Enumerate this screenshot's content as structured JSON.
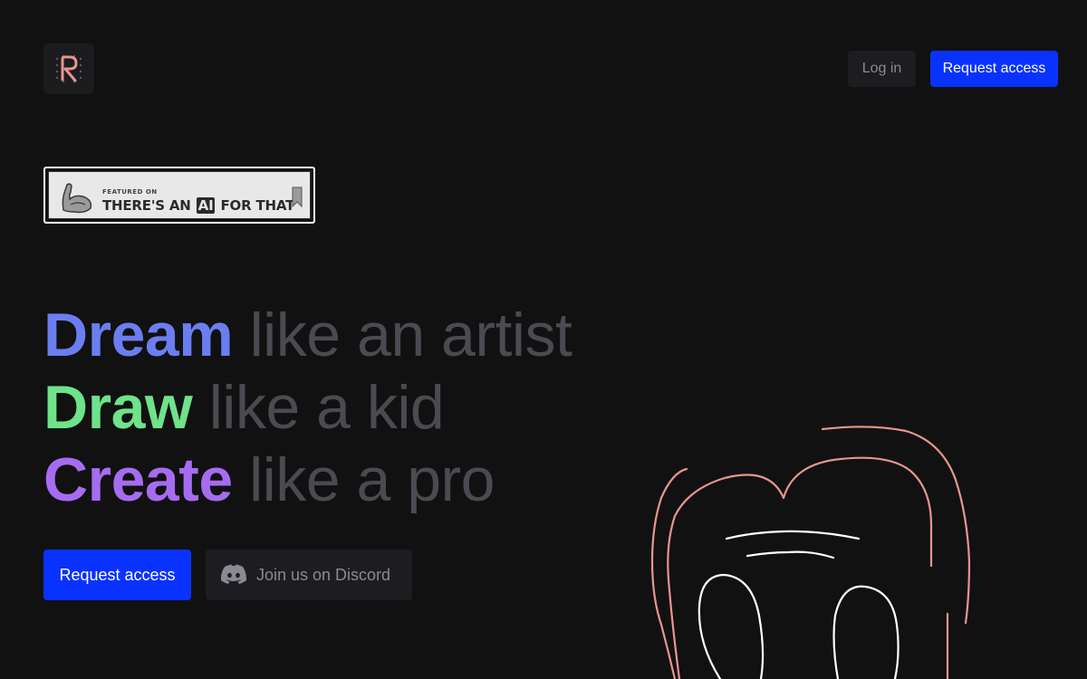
{
  "header": {
    "logo_letter": "R",
    "login_label": "Log in",
    "request_access_label": "Request access"
  },
  "badge": {
    "small_text": "FEATURED ON",
    "big_text_before": "THERE'S AN",
    "big_text_ai": "AI",
    "big_text_after": "FOR THAT"
  },
  "hero": {
    "lines": [
      {
        "strong": "Dream",
        "soft": "like an artist",
        "color": "#6b7ef0"
      },
      {
        "strong": "Draw",
        "soft": "like a kid",
        "color": "#6ee389"
      },
      {
        "strong": "Create",
        "soft": "like a pro",
        "color": "#a66cf0"
      }
    ]
  },
  "cta": {
    "request_access_label": "Request access",
    "discord_label": "Join us on Discord"
  },
  "colors": {
    "accent_blue": "#0a32ff",
    "background": "#111112",
    "sketch_pink": "#e8958f",
    "sketch_white": "#ffffff"
  }
}
